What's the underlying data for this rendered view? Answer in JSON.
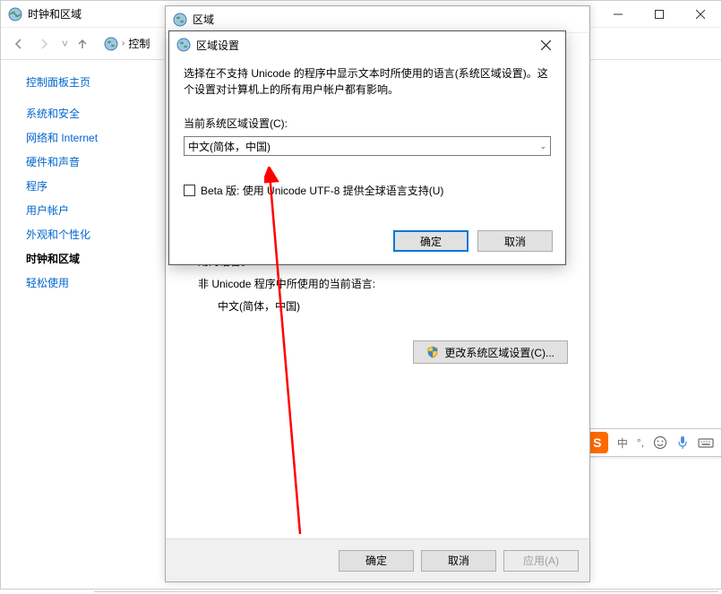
{
  "parent_window": {
    "title": "时钟和区域",
    "breadcrumb_item": "控制"
  },
  "sidebar": {
    "home": "控制面板主页",
    "items": [
      {
        "label": "系统和安全"
      },
      {
        "label": "网络和 Internet"
      },
      {
        "label": "硬件和声音"
      },
      {
        "label": "程序"
      },
      {
        "label": "用户帐户"
      },
      {
        "label": "外观和个性化"
      },
      {
        "label": "时钟和区域"
      },
      {
        "label": "轻松使用"
      }
    ]
  },
  "region_dialog": {
    "title": "区域",
    "used_language_label": "用的语言。",
    "non_unicode_label": "非 Unicode 程序中所使用的当前语言:",
    "current_language": "中文(简体，中国)",
    "change_button": "更改系统区域设置(C)...",
    "ok": "确定",
    "cancel": "取消",
    "apply": "应用(A)"
  },
  "settings_dialog": {
    "title": "区域设置",
    "description": "选择在不支持 Unicode 的程序中显示文本时所使用的语言(系统区域设置)。这个设置对计算机上的所有用户帐户都有影响。",
    "locale_label": "当前系统区域设置(C):",
    "locale_value": "中文(简体，中国)",
    "beta_label": "Beta 版: 使用 Unicode UTF-8 提供全球语言支持(U)",
    "ok": "确定",
    "cancel": "取消"
  },
  "ime": {
    "mode": "中",
    "punct": "°,",
    "face": "☺",
    "mic": "🎤",
    "keyboard": "⌨"
  }
}
